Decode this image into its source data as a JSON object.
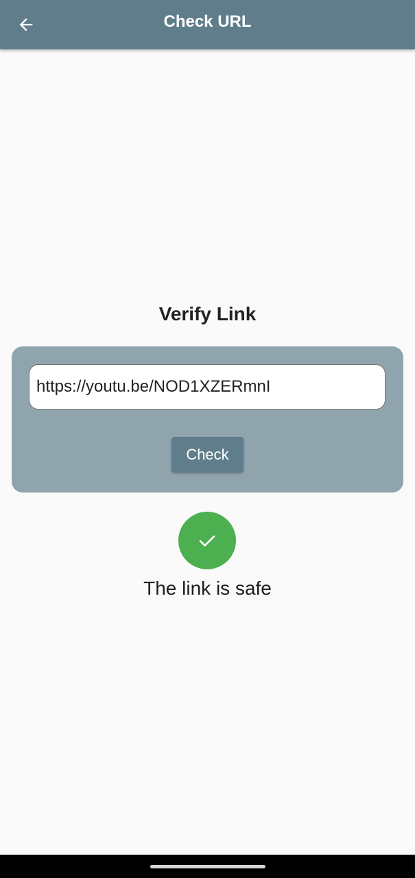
{
  "appbar": {
    "title": "Check URL",
    "back_icon": "arrow-left-icon",
    "color": "#607d8b"
  },
  "main": {
    "heading": "Verify Link",
    "url_input": {
      "value": "https://youtu.be/NOD1XZERmnI"
    },
    "check_button": {
      "label": "Check"
    },
    "result": {
      "icon": "check-icon",
      "status_color": "#4caf50",
      "text": "The link is safe"
    }
  },
  "colors": {
    "card_background": "#90a4ae",
    "page_background": "#fafafa"
  }
}
